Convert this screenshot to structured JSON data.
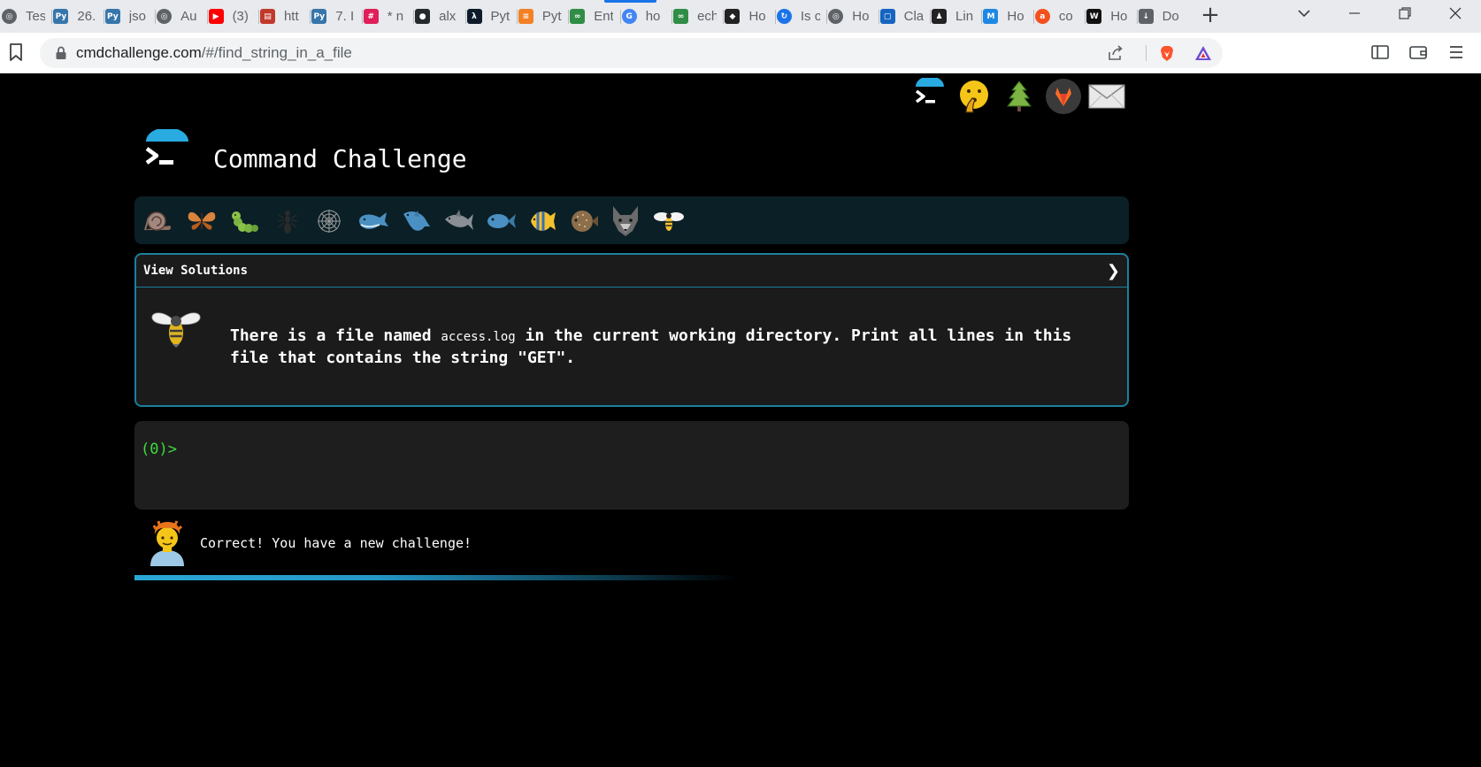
{
  "browser": {
    "tabs": [
      {
        "title": "Tes",
        "icon": "globe-icon",
        "color": "#5f6368"
      },
      {
        "title": "26.",
        "icon": "python-icon",
        "color": "#3776ab"
      },
      {
        "title": "jso",
        "icon": "python-icon",
        "color": "#3776ab"
      },
      {
        "title": "Au",
        "icon": "globe-icon",
        "color": "#5f6368"
      },
      {
        "title": "(3)",
        "icon": "youtube-icon",
        "color": "#ff0000"
      },
      {
        "title": "htt",
        "icon": "page-icon",
        "color": "#c0392b"
      },
      {
        "title": "7. I",
        "icon": "python-icon",
        "color": "#3776ab"
      },
      {
        "title": "* n",
        "icon": "slack-icon",
        "color": "#e01e5a"
      },
      {
        "title": "alx",
        "icon": "github-icon",
        "color": "#24292e"
      },
      {
        "title": "Pyt",
        "icon": "code-icon",
        "color": "#0d1b2a"
      },
      {
        "title": "Pyt",
        "icon": "stackoverflow-icon",
        "color": "#f48024"
      },
      {
        "title": "Ent",
        "icon": "geeks-icon",
        "color": "#2f8d46"
      },
      {
        "title": "ho",
        "icon": "google-icon",
        "color": "#4285f4"
      },
      {
        "title": "ech",
        "icon": "geeks-icon",
        "color": "#2f8d46"
      },
      {
        "title": "Ho",
        "icon": "diamond-icon",
        "color": "#222222"
      },
      {
        "title": "Is c",
        "icon": "refresh-icon",
        "color": "#1a73e8"
      },
      {
        "title": "Ho",
        "icon": "globe-icon",
        "color": "#5f6368"
      },
      {
        "title": "Cla",
        "icon": "square-icon",
        "color": "#1565c0"
      },
      {
        "title": "Lin",
        "icon": "penguin-icon",
        "color": "#222222"
      },
      {
        "title": "Ho",
        "icon": "m-icon",
        "color": "#1e88e5"
      },
      {
        "title": "co",
        "icon": "ask-icon",
        "color": "#f4511e"
      },
      {
        "title": "Ho",
        "icon": "w-icon",
        "color": "#111111"
      },
      {
        "title": "Do",
        "icon": "download-icon",
        "color": "#5f6368"
      }
    ],
    "url_host": "cmdchallenge.com",
    "url_path": "/#/find_string_in_a_file"
  },
  "site": {
    "title": "Command Challenge",
    "logo_color": "#29abe2"
  },
  "social_links": [
    "terminal-icon",
    "shush-face-icon",
    "tree-icon",
    "gitlab-icon",
    "mail-icon"
  ],
  "progress_animals": [
    "snail-icon",
    "butterfly-icon",
    "caterpillar-icon",
    "ant-icon",
    "spider-web-icon",
    "whale-icon",
    "dolphin-icon",
    "dolphin-icon",
    "fish-icon",
    "tropical-fish-icon",
    "blowfish-icon",
    "wolf-icon",
    "bee-icon"
  ],
  "challenge": {
    "view_solutions_label": "View Solutions",
    "text_before": "There is a file named ",
    "filename": "access.log",
    "text_after": " in the current working directory. Print all lines in this file that contains the string \"GET\".",
    "animal": "bee-icon"
  },
  "terminal": {
    "prompt": "(0)>"
  },
  "feedback": {
    "message": "Correct! You have a new challenge!",
    "avatar": "person-icon"
  },
  "colors": {
    "accent": "#29abe2",
    "card_border": "#1c7f9e",
    "prompt_green": "#3ddc3d"
  }
}
